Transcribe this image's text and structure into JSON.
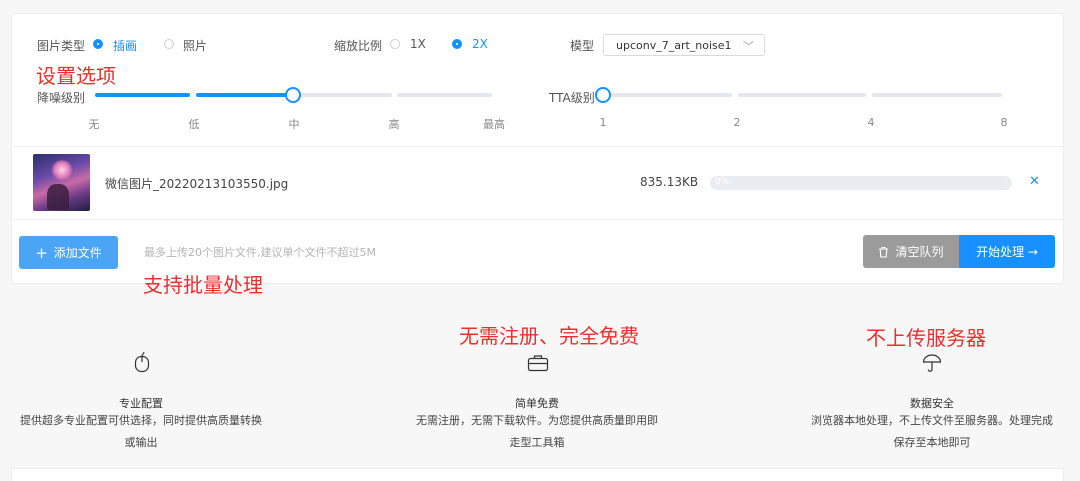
{
  "settings": {
    "image_type_label": "图片类型",
    "image_type_options": [
      "插画",
      "照片"
    ],
    "image_type_selected": "插画",
    "scale_label": "缩放比例",
    "scale_options": [
      "1X",
      "2X"
    ],
    "scale_selected": "2X",
    "model_label": "模型",
    "model_value": "upconv_7_art_noise1",
    "noise_label": "降噪级别",
    "noise_ticks": [
      "无",
      "低",
      "中",
      "高",
      "最高"
    ],
    "noise_value": "中",
    "tta_label": "TTA级别",
    "tta_ticks": [
      "1",
      "2",
      "4",
      "8"
    ],
    "tta_value": "1"
  },
  "file": {
    "name": "微信图片_20220213103550.jpg",
    "size": "835.13KB",
    "progress_text": "0%",
    "progress": 0
  },
  "actions": {
    "add_label": "添加文件",
    "hint": "最多上传20个图片文件,建议单个文件不超过5M",
    "clear_label": "清空队列",
    "start_label": "开始处理 →"
  },
  "annotations": {
    "settings": "设置选项",
    "batch": "支持批量处理",
    "free": "无需注册、完全免费",
    "no_upload": "不上传服务器"
  },
  "features": [
    {
      "icon": "mouse-icon",
      "title": "专业配置",
      "desc_line1": "提供超多专业配置可供选择，同时提供高质量转换",
      "desc_line2": "或输出"
    },
    {
      "icon": "briefcase-icon",
      "title": "简单免费",
      "desc_line1": "无需注册，无需下载软件。为您提供高质量即用即",
      "desc_line2": "走型工具箱"
    },
    {
      "icon": "umbrella-icon",
      "title": "数据安全",
      "desc_line1": "浏览器本地处理，不上传文件至服务器。处理完成",
      "desc_line2": "保存至本地即可"
    }
  ],
  "colors": {
    "primary": "#1890ff",
    "clear_button": "#9b9b9b",
    "annotation": "#e8312f"
  }
}
